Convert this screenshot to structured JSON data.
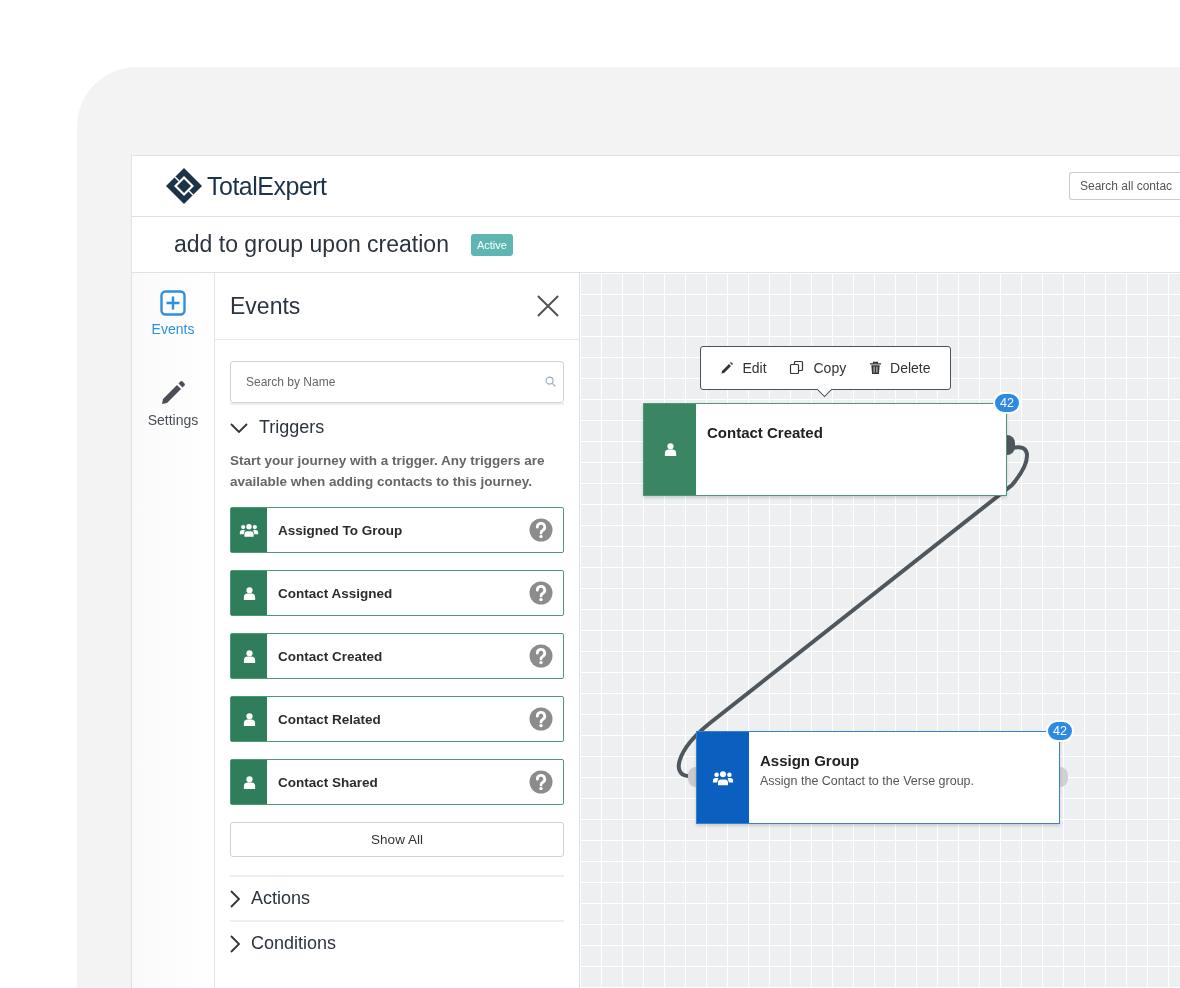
{
  "header": {
    "logo": "TotalExpert",
    "search": {
      "placeholder": "Search all contac"
    }
  },
  "journey": {
    "title": "add to group upon creation",
    "status": "Active"
  },
  "rail": [
    {
      "label": "Events",
      "kind": "add",
      "selected": true
    },
    {
      "label": "Settings",
      "kind": "edit",
      "selected": false
    }
  ],
  "panel": {
    "title": "Events",
    "search": {
      "placeholder": "Search by Name"
    },
    "sections": [
      {
        "title": "Triggers",
        "expanded": true,
        "description": "Start your journey with a trigger. Any triggers are available when adding contacts to this journey.",
        "items": [
          {
            "label": "Assigned To Group",
            "kind": "group"
          },
          {
            "label": "Contact Assigned",
            "kind": "person"
          },
          {
            "label": "Contact Created",
            "kind": "person"
          },
          {
            "label": "Contact Related",
            "kind": "person"
          },
          {
            "label": "Contact Shared",
            "kind": "person"
          }
        ],
        "button": "Show All"
      },
      {
        "title": "Actions",
        "expanded": false
      },
      {
        "title": "Conditions",
        "expanded": false
      }
    ]
  },
  "canvas": {
    "toolbar": [
      {
        "label": "Edit",
        "kind": "edit"
      },
      {
        "label": "Copy",
        "kind": "copy"
      },
      {
        "label": "Delete",
        "kind": "delete"
      }
    ],
    "nodes": [
      {
        "kind": "trigger",
        "title": "Contact Created",
        "count": "42"
      },
      {
        "kind": "action",
        "title": "Assign Group",
        "description": "Assign the Contact to the Verse group.",
        "count": "42"
      }
    ]
  }
}
